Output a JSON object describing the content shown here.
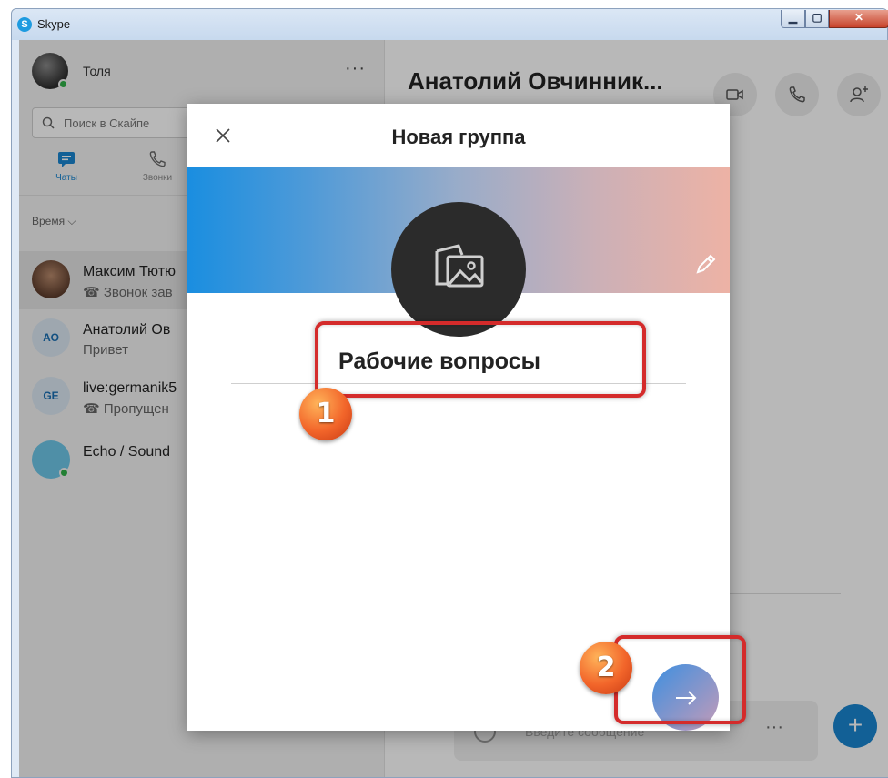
{
  "window": {
    "title": "Skype",
    "logo_letter": "S"
  },
  "profile": {
    "name": "Толя",
    "menu": "···"
  },
  "search": {
    "placeholder": "Поиск в Скайпе"
  },
  "nav_tabs": [
    {
      "label": "Чаты",
      "icon": "chat-icon",
      "active": true
    },
    {
      "label": "Звонки",
      "icon": "phone-icon",
      "active": false
    }
  ],
  "sort_label": "Время ⌵",
  "contacts": [
    {
      "name": "Максим Тютю",
      "sub": "☎ Звонок зав",
      "initials": ""
    },
    {
      "name": "Анатолий Ов",
      "sub": "Привет",
      "initials": "АО"
    },
    {
      "name": "live:germanik5",
      "sub": "☎ Пропущен",
      "initials": "GE"
    },
    {
      "name": "Echo / Sound",
      "sub": "",
      "initials": ""
    }
  ],
  "chat": {
    "title": "Анатолий Овчинник...",
    "composer_placeholder": "Введите сообщение",
    "composer_more": "···",
    "add_button": "+"
  },
  "dialog": {
    "title": "Новая группа",
    "group_name": "Рабочие вопросы"
  },
  "markers": [
    "1",
    "2"
  ],
  "colors": {
    "accent": "#1a86d0",
    "highlight": "#d42b2b",
    "marker": "#f2652a"
  }
}
